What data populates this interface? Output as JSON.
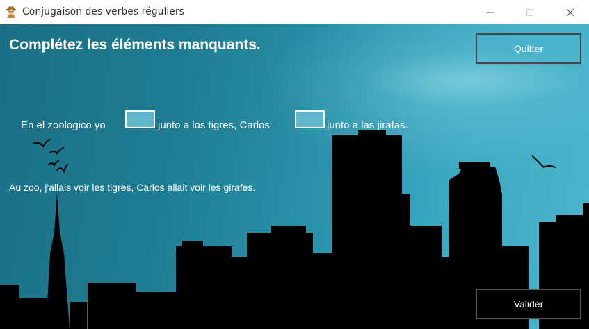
{
  "window": {
    "title": "Conjugaison des verbes réguliers",
    "icon": "spy-character-icon",
    "controls": [
      "minimize-icon",
      "maximize-icon",
      "close-icon"
    ]
  },
  "exercise": {
    "heading": "Complétez les éléments manquants.",
    "sentence_part1": "En el zoologico yo",
    "blank1_value": "",
    "sentence_part2": "junto a los tigres, Carlos",
    "blank2_value": "",
    "sentence_part3": "junto a las jirafas.",
    "translation": "Au zoo, j'allais voir les tigres, Carlos allait voir les girafes."
  },
  "buttons": {
    "quit_label": "Quitter",
    "validate_label": "Valider"
  },
  "colors": {
    "sky_dark": "#1b6f84",
    "sky_light": "#4cb6cc",
    "input_fill": "#62b6c9",
    "skyline": "#000000"
  }
}
